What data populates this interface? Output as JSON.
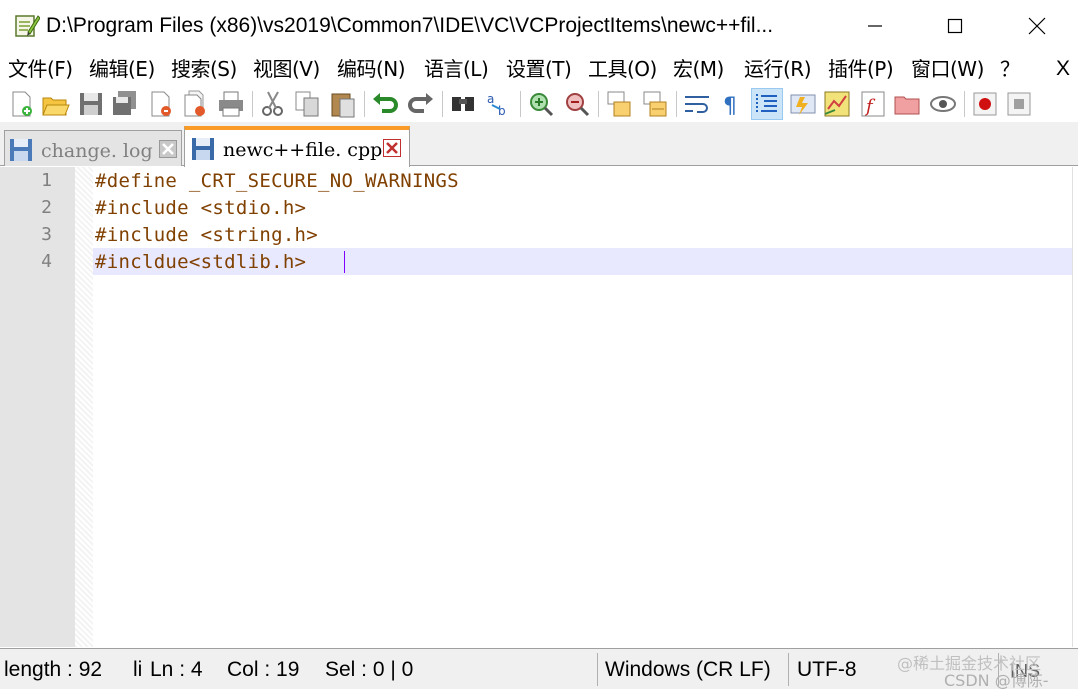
{
  "window": {
    "title": "D:\\Program Files (x86)\\vs2019\\Common7\\IDE\\VC\\VCProjectItems\\newc++fil...",
    "app_icon": "notepad-plus-plus-icon"
  },
  "menu": {
    "items": [
      "文件(F)",
      "编辑(E)",
      "搜索(S)",
      "视图(V)",
      "编码(N)",
      "语言(L)",
      "设置(T)",
      "工具(O)",
      "宏(M)",
      "运行(R)",
      "插件(P)",
      "窗口(W)",
      "？"
    ],
    "close_label": "X"
  },
  "toolbar": {
    "icons": [
      "new-file-icon",
      "open-file-icon",
      "save-icon",
      "save-all-icon",
      "close-icon",
      "close-all-icon",
      "print-icon",
      "cut-icon",
      "copy-icon",
      "paste-icon",
      "undo-icon",
      "redo-icon",
      "find-icon",
      "replace-icon",
      "zoom-in-icon",
      "zoom-out-icon",
      "sync-vertical-icon",
      "sync-horizontal-icon",
      "word-wrap-icon",
      "show-all-chars-icon",
      "indent-guide-icon",
      "user-language-icon",
      "document-map-icon",
      "function-list-icon",
      "folder-workspace-icon",
      "monitoring-icon",
      "record-macro-icon",
      "stop-record-icon"
    ]
  },
  "tabs": [
    {
      "label": "change. log",
      "active": false
    },
    {
      "label": "newc++file. cpp",
      "active": true
    }
  ],
  "editor": {
    "line_numbers": [
      "1",
      "2",
      "3",
      "4"
    ],
    "lines": [
      "#define _CRT_SECURE_NO_WARNINGS",
      "#include <stdio.h>",
      "#include <string.h>",
      "#incldue<stdlib.h>"
    ],
    "current_line": 4,
    "colors": {
      "preprocessor": "#804000",
      "current_line_bg": "#e8e8ff",
      "caret": "#8000ff",
      "tab_accent": "#fa9b28"
    }
  },
  "status": {
    "length": "length : 92",
    "lines_cut": "li",
    "ln": "Ln : 4",
    "col": "Col : 19",
    "sel": "Sel : 0 | 0",
    "eol": "Windows (CR LF)",
    "encoding": "UTF-8",
    "mode": "INS"
  },
  "watermarks": {
    "line1": "@稀土掘金技术社区",
    "line2": "CSDN @博陈-"
  }
}
